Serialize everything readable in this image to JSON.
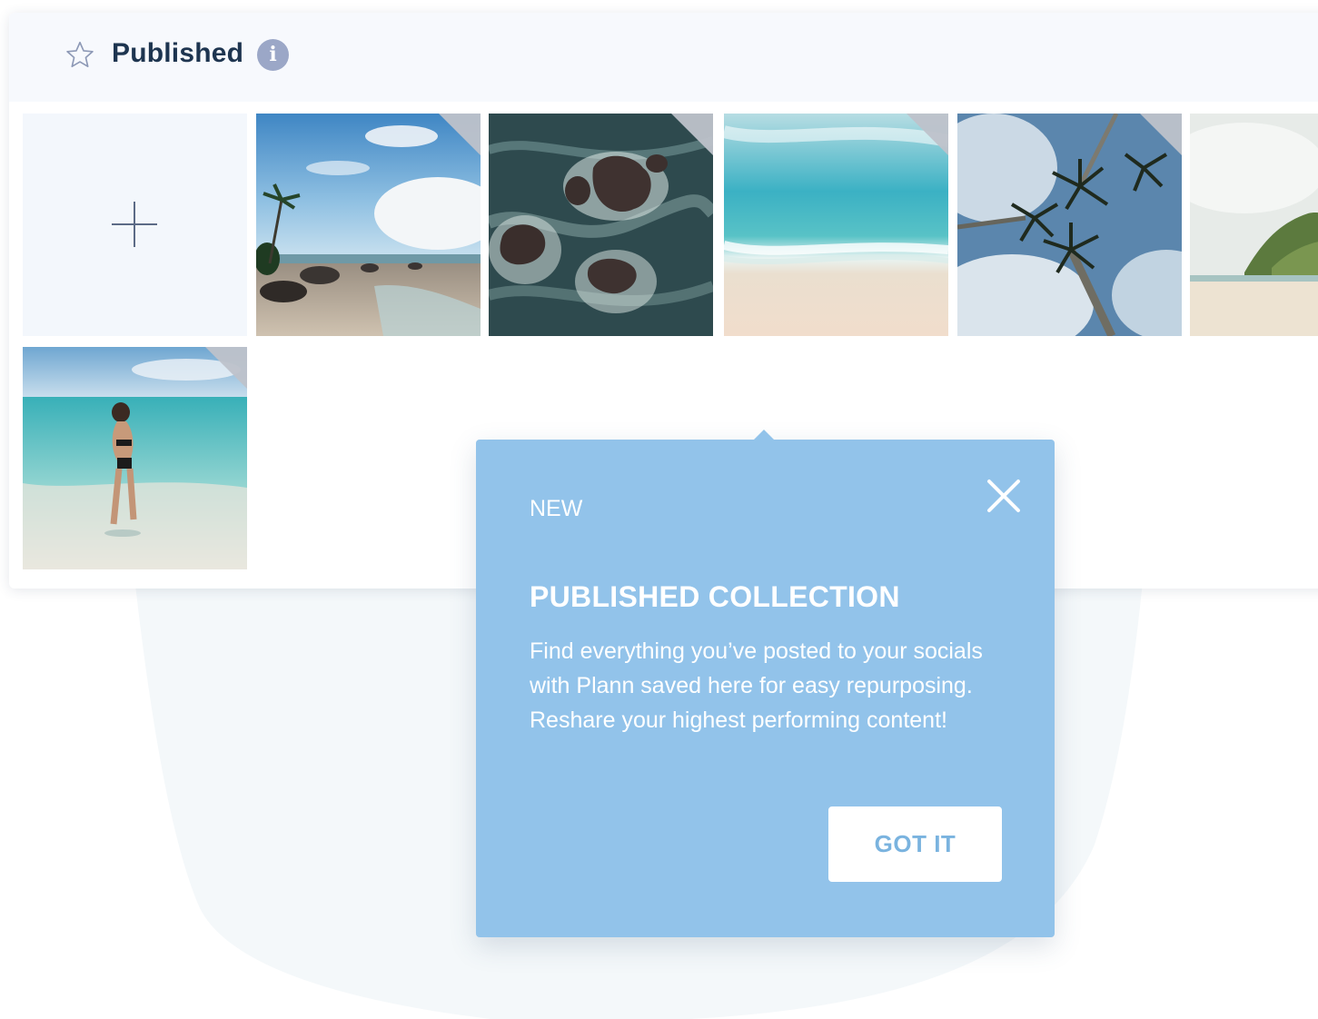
{
  "header": {
    "title": "Published",
    "star_icon": "star-outline-icon",
    "info_icon": "info-icon",
    "info_glyph": "i"
  },
  "gallery": {
    "add_tile_icon": "plus-icon",
    "items": [
      {
        "name": "beach-rocks-palm",
        "scene": "rocky beach with palm trees and clouds"
      },
      {
        "name": "aerial-ocean-rocks",
        "scene": "aerial view of dark rocks in foaming sea"
      },
      {
        "name": "aerial-turquoise-shore",
        "scene": "aerial turquoise waves on sand"
      },
      {
        "name": "palm-trees-sky",
        "scene": "palm trees from below against sky"
      },
      {
        "name": "sandy-beach-hill",
        "scene": "sandy beach with green headland"
      },
      {
        "name": "woman-in-shallow-water",
        "scene": "woman standing in shallow turquoise water"
      }
    ]
  },
  "tooltip": {
    "badge": "NEW",
    "title": "PUBLISHED COLLECTION",
    "body": "Find everything you’ve posted to your socials with Plann saved here for easy repurposing. Reshare your highest performing content!",
    "button_label": "GOT IT",
    "close_icon": "close-icon"
  },
  "colors": {
    "accent": "#92c3ea",
    "title_text": "#1e3550",
    "button_text": "#7ab3df"
  }
}
